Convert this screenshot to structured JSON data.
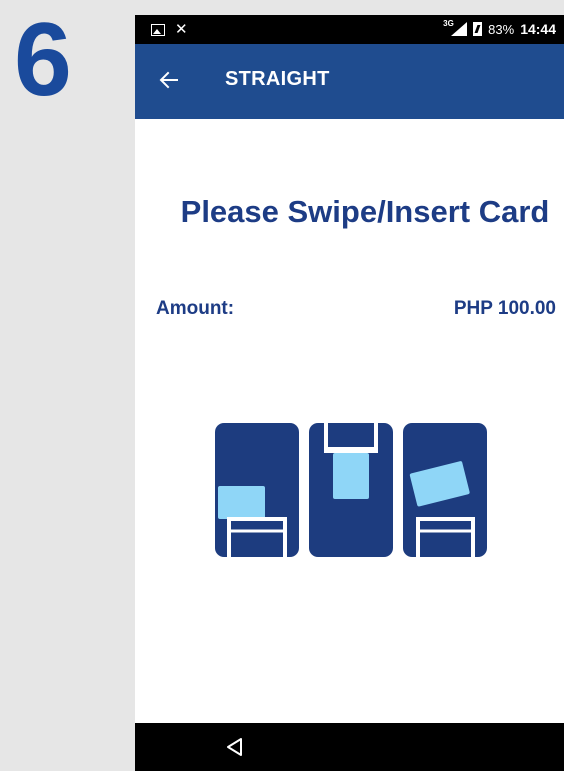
{
  "step": {
    "number": "6"
  },
  "status_bar": {
    "network": "3G",
    "battery_percent": "83%",
    "time": "14:44",
    "icons": [
      "image-icon",
      "missed-call-icon",
      "signal-icon",
      "battery-charging-icon"
    ]
  },
  "app_bar": {
    "title": "STRAIGHT",
    "back_icon": "arrow-left-icon"
  },
  "main": {
    "prompt": "Please Swipe/Insert Card",
    "amount_label": "Amount:",
    "amount_value": "PHP 100.00",
    "illustration": "swipe-insert-tap-card-icon"
  },
  "nav_bar": {
    "back_icon": "nav-back-triangle-icon"
  },
  "colors": {
    "primary": "#1f4c8f",
    "text_blue": "#1d3c85",
    "illustration_dark": "#1d3c7f",
    "card_light": "#8fd6f7",
    "step_number": "#1a4a9c",
    "background": "#e6e6e6"
  }
}
